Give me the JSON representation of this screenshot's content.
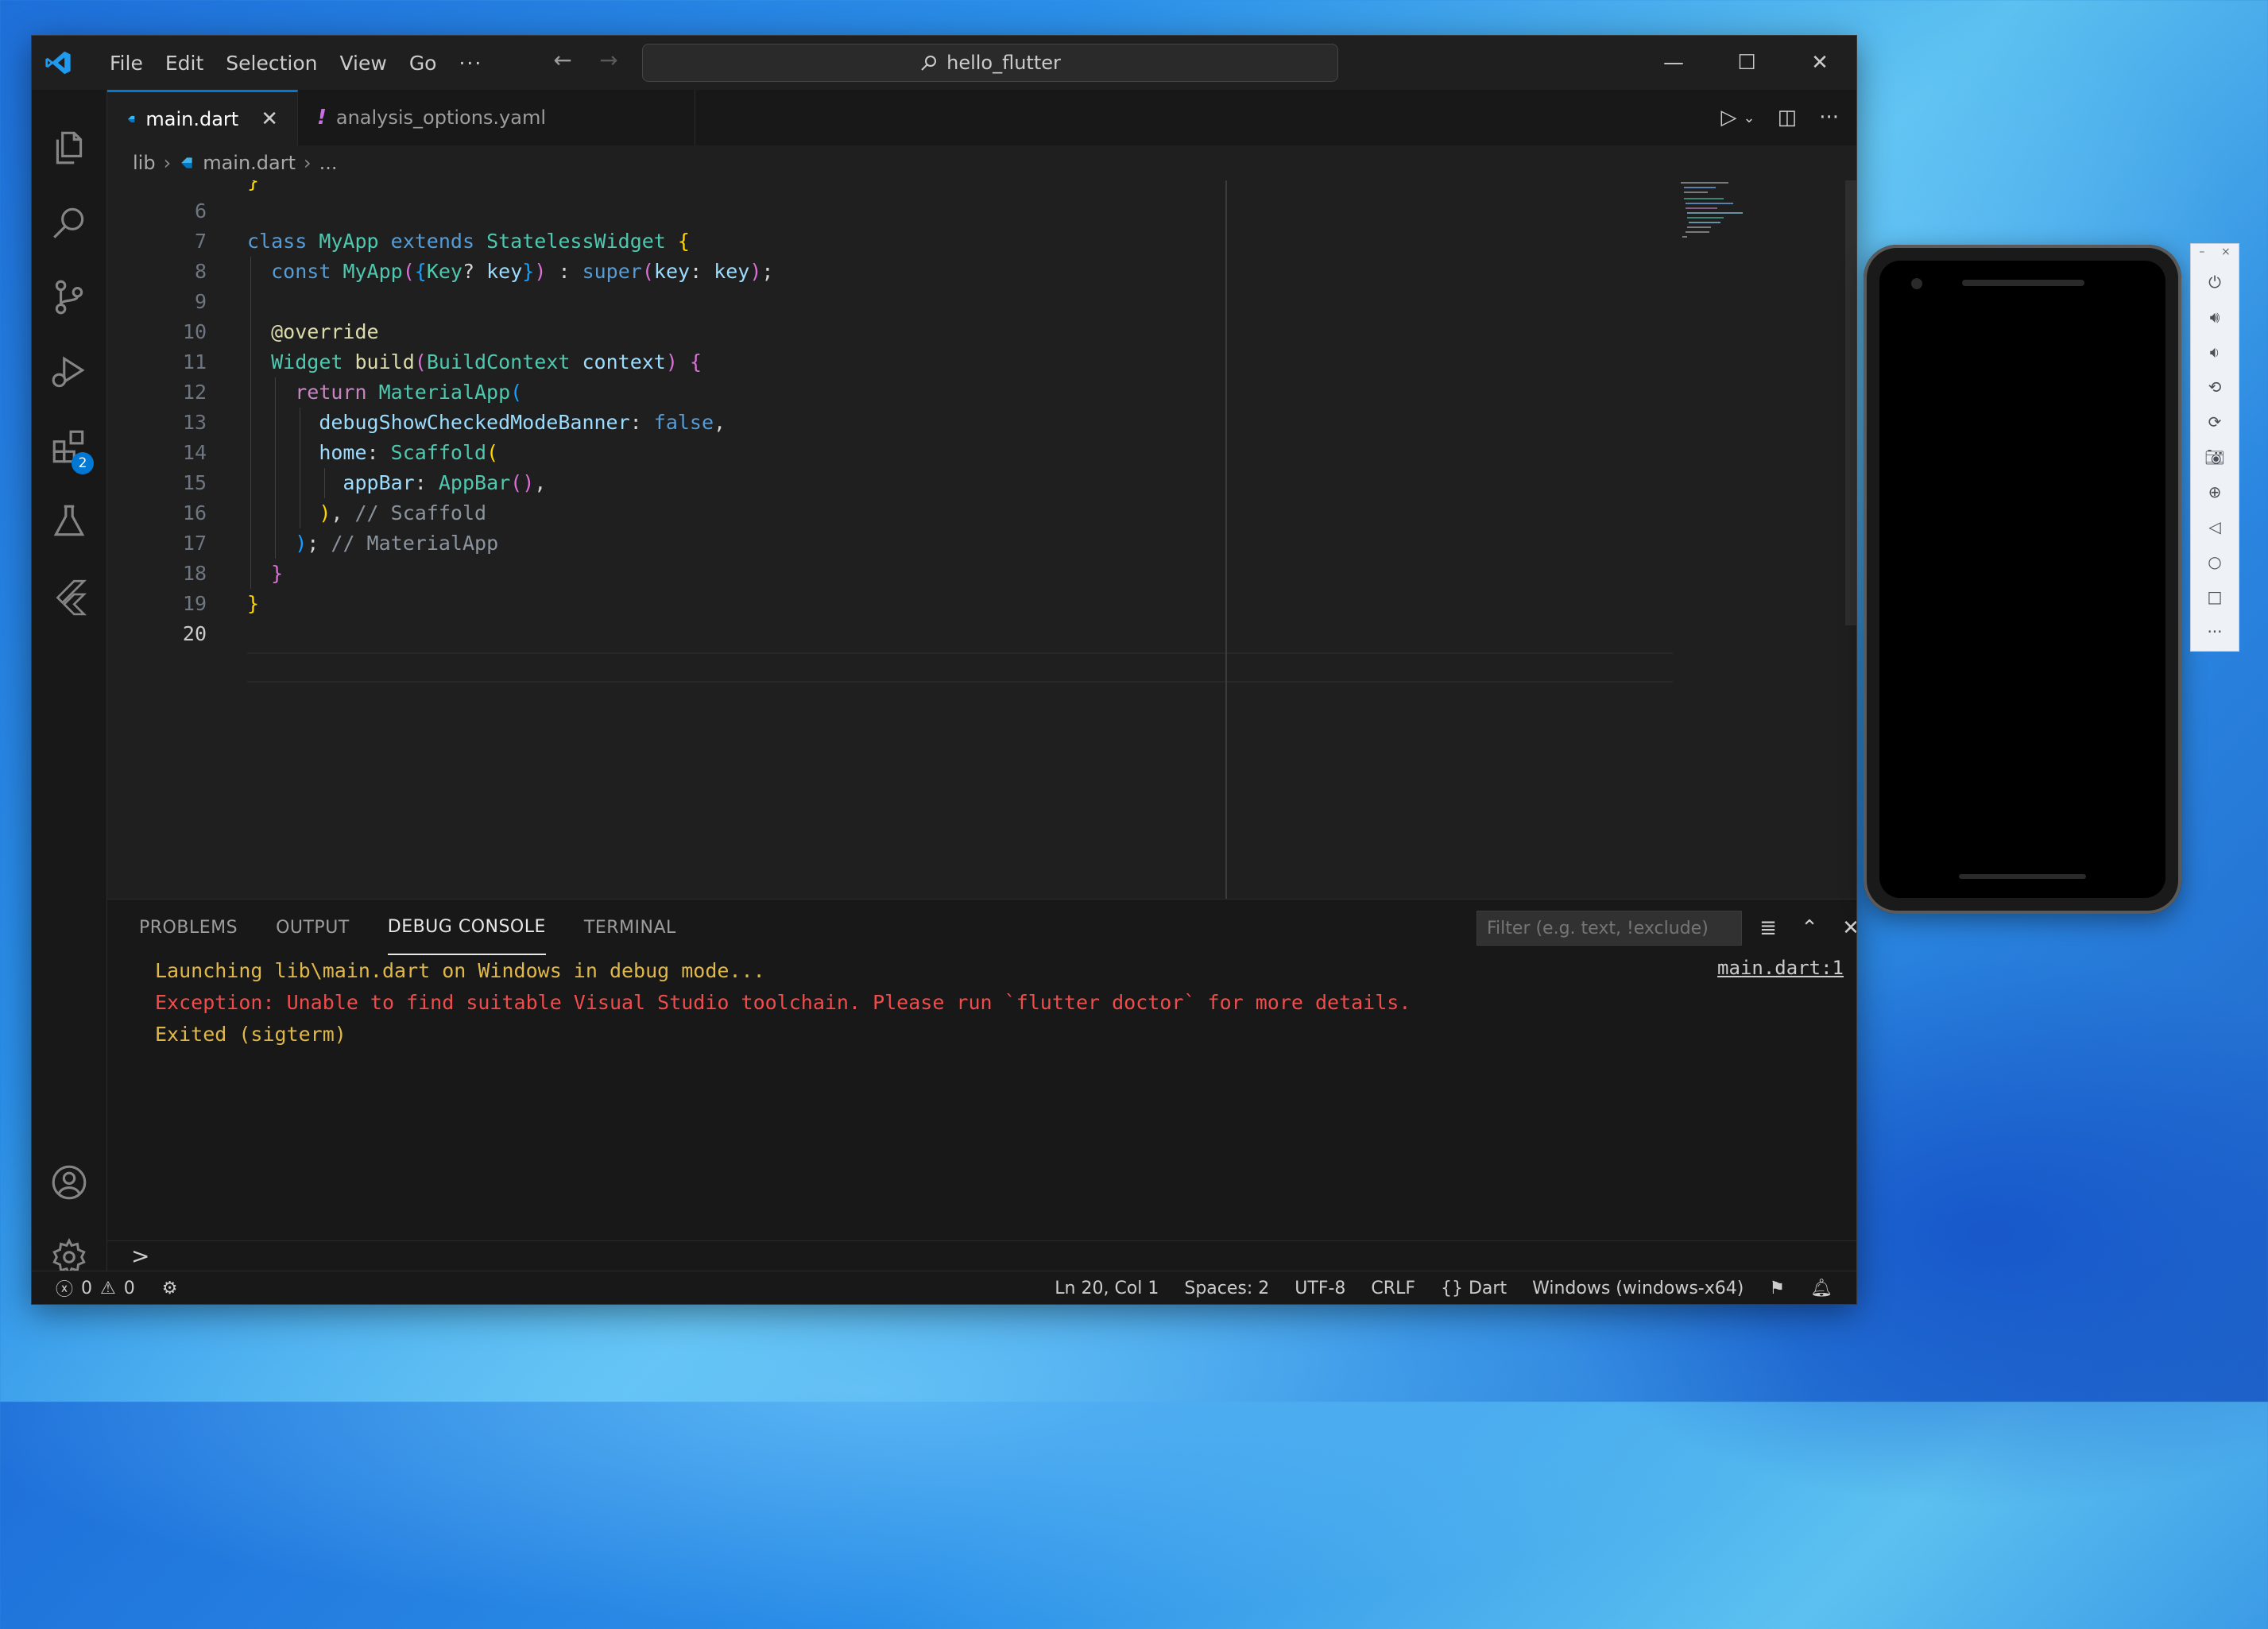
{
  "window": {
    "menu": [
      "File",
      "Edit",
      "Selection",
      "View",
      "Go"
    ],
    "menu_more": "···",
    "search_label": "hello_flutter"
  },
  "activity": {
    "extensions_badge": "2"
  },
  "tabs": [
    {
      "label": "main.dart",
      "active": true
    },
    {
      "label": "analysis_options.yaml",
      "active": false,
      "warning_mark": "!"
    }
  ],
  "breadcrumb": {
    "folder": "lib",
    "file": "main.dart",
    "rest": "..."
  },
  "code": {
    "line_numbers": [
      "6",
      "7",
      "8",
      "9",
      "10",
      "11",
      "12",
      "13",
      "14",
      "15",
      "16",
      "17",
      "18",
      "19",
      "20"
    ],
    "current_line": "20"
  },
  "panel": {
    "tabs": [
      "PROBLEMS",
      "OUTPUT",
      "DEBUG CONSOLE",
      "TERMINAL"
    ],
    "active_tab": "DEBUG CONSOLE",
    "filter_placeholder": "Filter (e.g. text, !exclude)",
    "console_lines": [
      {
        "text": "Launching lib\\main.dart on Windows in debug mode...",
        "level": "info"
      },
      {
        "text": "Exception: Unable to find suitable Visual Studio toolchain. Please run `flutter doctor` for more details.",
        "level": "error"
      },
      {
        "text": "Exited (sigterm)",
        "level": "info"
      }
    ],
    "source_link": "main.dart:1",
    "repl_prompt": ">"
  },
  "statusbar": {
    "errors": "0",
    "warnings": "0",
    "position": "Ln 20, Col 1",
    "spaces": "Spaces: 2",
    "encoding": "UTF-8",
    "eol": "CRLF",
    "language_icon": "{}",
    "language": "Dart",
    "device": "Windows (windows-x64)"
  },
  "colors": {
    "accent": "#0078d4",
    "error": "#f14c4c",
    "info": "#e0b84a"
  }
}
